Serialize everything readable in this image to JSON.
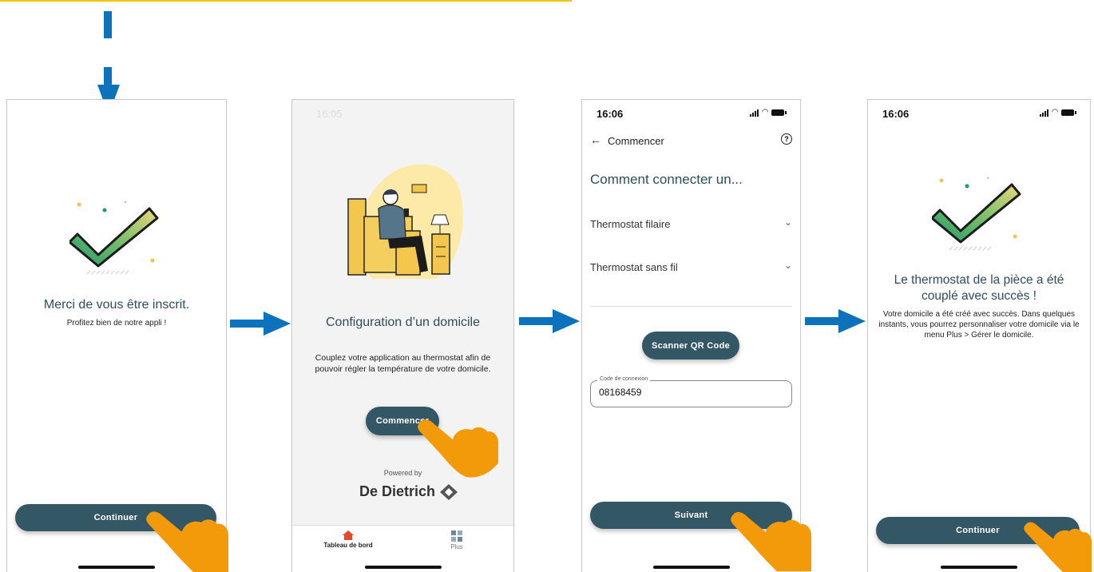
{
  "screens": {
    "s1": {
      "title": "Merci de vous être inscrit.",
      "subtitle": "Profitez bien de notre appli !",
      "button": "Continuer"
    },
    "s2": {
      "status_time": "16:05",
      "title": "Configuration d’un domicile",
      "description": "Couplez votre application au thermostat afin de pouvoir régler la température de votre domicile.",
      "button": "Commencer",
      "powered_by": "Powered by",
      "brand": "De Dietrich",
      "tabs": [
        {
          "label": "Tableau de bord",
          "icon": "home-icon"
        },
        {
          "label": "Plus",
          "icon": "grid-icon"
        }
      ]
    },
    "s3": {
      "status_time": "16:06",
      "back_label": "Commencer",
      "heading": "Comment connecter un...",
      "accordion": [
        {
          "label": "Thermostat filaire"
        },
        {
          "label": "Thermostat sans fil"
        }
      ],
      "scan_button": "Scanner QR Code",
      "code_label": "Code de connexion",
      "code_value": "08168459",
      "next_button": "Suivant"
    },
    "s4": {
      "status_time": "16:06",
      "title": "Le thermostat de la pièce a été couplé avec succès !",
      "description": "Votre domicile a été créé avec succès. Dans quelques instants, vous pourrez personnaliser votre domicile via le menu Plus > Gérer le domicile.",
      "button": "Continuer"
    }
  },
  "colors": {
    "accent": "#345766",
    "arrow": "#0b72bb",
    "hand": "#f39a0a",
    "title_text": "#2e4d5c",
    "top_line": "#f5c400"
  }
}
